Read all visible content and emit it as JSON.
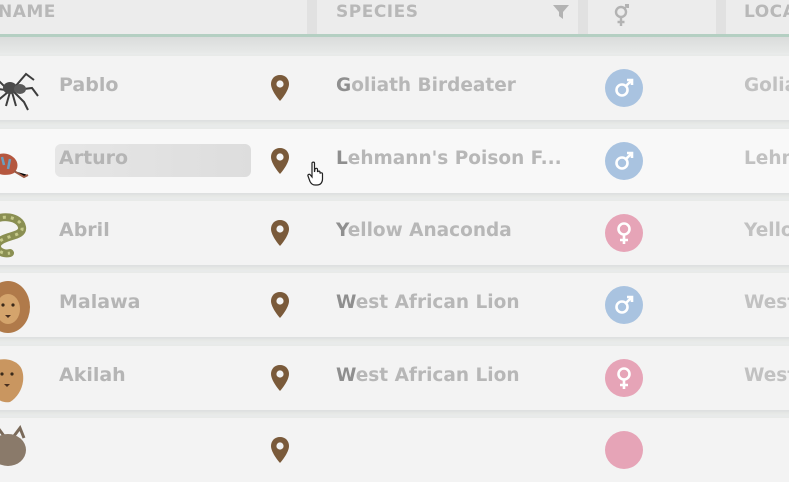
{
  "header": {
    "name_label": "NAME",
    "species_label": "SPECIES",
    "location_label": "LOCA"
  },
  "animals": [
    {
      "name": "Pablo",
      "species_first": "G",
      "species_rest": "oliath Birdeater",
      "gender": "male",
      "location": "Golia",
      "avatar": "spider-avatar"
    },
    {
      "name": "Arturo",
      "species_first": "L",
      "species_rest": "ehmann's Poison F...",
      "gender": "male",
      "location": "Lehm",
      "avatar": "frog-avatar"
    },
    {
      "name": "Abril",
      "species_first": "Y",
      "species_rest": "ellow Anaconda",
      "gender": "female",
      "location": "Yello",
      "avatar": "snake-avatar"
    },
    {
      "name": "Malawa",
      "species_first": "W",
      "species_rest": "est African Lion",
      "gender": "male",
      "location": "West",
      "avatar": "lion-avatar"
    },
    {
      "name": "Akilah",
      "species_first": "W",
      "species_rest": "est African Lion",
      "gender": "female",
      "location": "West",
      "avatar": "lioness-avatar"
    },
    {
      "name": "",
      "species_first": "",
      "species_rest": "",
      "gender": "female",
      "location": "",
      "avatar": "cat-avatar"
    }
  ],
  "colors": {
    "male": "#a9c3e0",
    "female": "#e6a4b7",
    "pin": "#7a5a3a",
    "header_accent": "#b4cfc2"
  },
  "icons": [
    "filter-icon",
    "gender-symbol-icon",
    "map-pin-icon",
    "male-icon",
    "female-icon",
    "hand-pointer-cursor"
  ]
}
